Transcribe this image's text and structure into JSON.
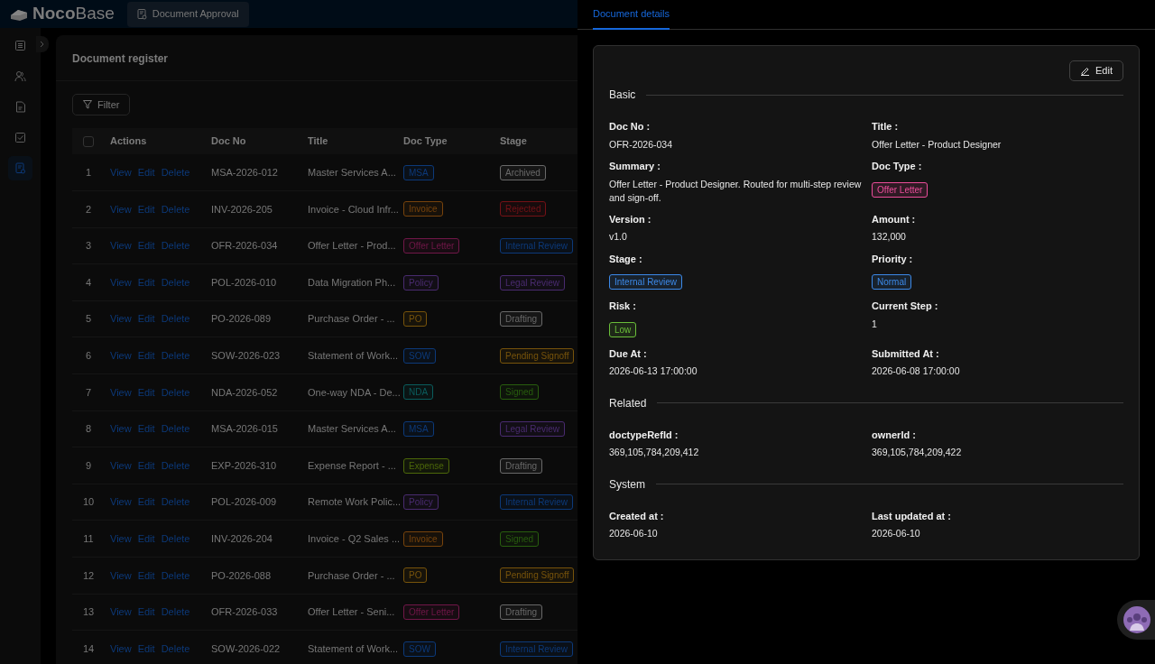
{
  "app": {
    "logo_bold_part": "Noco",
    "logo_light_part": "Base",
    "menu_tab": {
      "label": "Document Approval",
      "selected": true
    }
  },
  "sidebar": {
    "items": [
      {
        "kind": "list",
        "selected": false
      },
      {
        "kind": "users",
        "selected": false
      },
      {
        "kind": "file",
        "selected": false
      },
      {
        "kind": "check",
        "selected": false
      },
      {
        "kind": "doc",
        "selected": true
      }
    ]
  },
  "register": {
    "title": "Document register",
    "filter_label": "Filter",
    "select_all": {
      "checked": false
    },
    "columns": [
      "Actions",
      "Doc No",
      "Title",
      "Doc Type",
      "Stage"
    ],
    "rows": [
      {
        "index": "1",
        "actions": [
          "View",
          "Edit",
          "Delete"
        ],
        "doc_no": "MSA-2026-012",
        "title": "Master Services A...",
        "doc_type": {
          "text": "MSA",
          "color": "#0c3979"
        },
        "stage": {
          "text": "Archived",
          "color": "#696969"
        }
      },
      {
        "index": "2",
        "actions": [
          "View",
          "Edit",
          "Delete"
        ],
        "doc_no": "INV-2026-205",
        "title": "Invoice - Cloud Infr...",
        "doc_type": {
          "text": "Invoice",
          "color": "#77430c"
        },
        "stage": {
          "text": "Rejected",
          "color": "#741116"
        }
      },
      {
        "index": "3",
        "actions": [
          "View",
          "Edit",
          "Delete"
        ],
        "doc_no": "OFR-2026-034",
        "title": "Offer Letter - Prod...",
        "doc_type": {
          "text": "Offer Letter",
          "color": "#701748"
        },
        "stage": {
          "text": "Internal Review",
          "color": "#0c3979"
        }
      },
      {
        "index": "4",
        "actions": [
          "View",
          "Edit",
          "Delete"
        ],
        "doc_no": "POL-2026-010",
        "title": "Data Migration Ph...",
        "doc_type": {
          "text": "Policy",
          "color": "#492b6f"
        },
        "stage": {
          "text": "Legal Review",
          "color": "#492b6f"
        }
      },
      {
        "index": "5",
        "actions": [
          "View",
          "Edit",
          "Delete"
        ],
        "doc_no": "PO-2026-089",
        "title": "Purchase Order - ...",
        "doc_type": {
          "text": "PO",
          "color": "#77530b"
        },
        "stage": {
          "text": "Drafting",
          "color": "#696969"
        }
      },
      {
        "index": "6",
        "actions": [
          "View",
          "Edit",
          "Delete"
        ],
        "doc_no": "SOW-2026-023",
        "title": "Statement of Work...",
        "doc_type": {
          "text": "SOW",
          "color": "#0c3979"
        },
        "stage": {
          "text": "Pending Signoff",
          "color": "#77530b"
        }
      },
      {
        "index": "7",
        "actions": [
          "View",
          "Edit",
          "Delete"
        ],
        "doc_no": "NDA-2026-052",
        "title": "One-way NDA - De...",
        "doc_type": {
          "text": "NDA",
          "color": "#0a5c5c"
        },
        "stage": {
          "text": "Signed",
          "color": "#285d0e"
        }
      },
      {
        "index": "8",
        "actions": [
          "View",
          "Edit",
          "Delete"
        ],
        "doc_no": "MSA-2026-015",
        "title": "Master Services A...",
        "doc_type": {
          "text": "MSA",
          "color": "#0c3979"
        },
        "stage": {
          "text": "Legal Review",
          "color": "#492b6f"
        }
      },
      {
        "index": "9",
        "actions": [
          "View",
          "Edit",
          "Delete"
        ],
        "doc_no": "EXP-2026-310",
        "title": "Expense Report - ...",
        "doc_type": {
          "text": "Expense",
          "color": "#4c6709"
        },
        "stage": {
          "text": "Drafting",
          "color": "#696969"
        }
      },
      {
        "index": "10",
        "actions": [
          "View",
          "Edit",
          "Delete"
        ],
        "doc_no": "POL-2026-009",
        "title": "Remote Work Polic...",
        "doc_type": {
          "text": "Policy",
          "color": "#492b6f"
        },
        "stage": {
          "text": "Internal Review",
          "color": "#0c3979"
        }
      },
      {
        "index": "11",
        "actions": [
          "View",
          "Edit",
          "Delete"
        ],
        "doc_no": "INV-2026-204",
        "title": "Invoice - Q2 Sales ...",
        "doc_type": {
          "text": "Invoice",
          "color": "#77430c"
        },
        "stage": {
          "text": "Signed",
          "color": "#285d0e"
        }
      },
      {
        "index": "12",
        "actions": [
          "View",
          "Edit",
          "Delete"
        ],
        "doc_no": "PO-2026-088",
        "title": "Purchase Order - ...",
        "doc_type": {
          "text": "PO",
          "color": "#77530b"
        },
        "stage": {
          "text": "Pending Signoff",
          "color": "#77530b"
        }
      },
      {
        "index": "13",
        "actions": [
          "View",
          "Edit",
          "Delete"
        ],
        "doc_no": "OFR-2026-033",
        "title": "Offer Letter - Seni...",
        "doc_type": {
          "text": "Offer Letter",
          "color": "#701748"
        },
        "stage": {
          "text": "Drafting",
          "color": "#696969"
        }
      },
      {
        "index": "14",
        "actions": [
          "View",
          "Edit",
          "Delete"
        ],
        "doc_no": "SOW-2026-022",
        "title": "Statement of Work...",
        "doc_type": {
          "text": "SOW",
          "color": "#0c3979"
        },
        "stage": {
          "text": "Internal Review",
          "color": "#0c3979"
        }
      }
    ]
  },
  "drawer": {
    "tabs": [
      {
        "label": "Document details",
        "selected": true
      }
    ],
    "edit_label": "Edit",
    "sections": [
      {
        "title": "Basic",
        "fields": [
          {
            "label": "Doc No :",
            "kind": "text",
            "value": "OFR-2026-034"
          },
          {
            "label": "Title :",
            "kind": "text",
            "value": "Offer Letter - Product Designer"
          },
          {
            "label": "Summary :",
            "kind": "text",
            "value": "Offer Letter - Product Designer. Routed for multi-step review and sign-off."
          },
          {
            "label": "Doc Type :",
            "kind": "tag",
            "value": "Offer Letter",
            "color": "#eb4d9a"
          },
          {
            "label": "Version :",
            "kind": "text",
            "value": "v1.0"
          },
          {
            "label": "Amount :",
            "kind": "text",
            "value": "132,000"
          },
          {
            "label": "Stage :",
            "kind": "tag",
            "value": "Internal Review",
            "color": "#3c89e8"
          },
          {
            "label": "Priority :",
            "kind": "tag",
            "value": "Normal",
            "color": "#3c89e8"
          },
          {
            "label": "Risk :",
            "kind": "tag",
            "value": "Low",
            "color": "#6abe39"
          },
          {
            "label": "Current Step :",
            "kind": "text",
            "value": "1"
          },
          {
            "label": "Due At :",
            "kind": "text",
            "value": "2026-06-13 17:00:00"
          },
          {
            "label": "Submitted At :",
            "kind": "text",
            "value": "2026-06-08 17:00:00"
          }
        ]
      },
      {
        "title": "Related",
        "fields": [
          {
            "label": "doctypeRefId :",
            "kind": "text",
            "value": "369,105,784,209,412"
          },
          {
            "label": "ownerId :",
            "kind": "text",
            "value": "369,105,784,209,422"
          }
        ]
      },
      {
        "title": "System",
        "fields": [
          {
            "label": "Created at :",
            "kind": "text",
            "value": "2026-06-10"
          },
          {
            "label": "Last updated at :",
            "kind": "text",
            "value": "2026-06-10"
          }
        ]
      }
    ]
  }
}
